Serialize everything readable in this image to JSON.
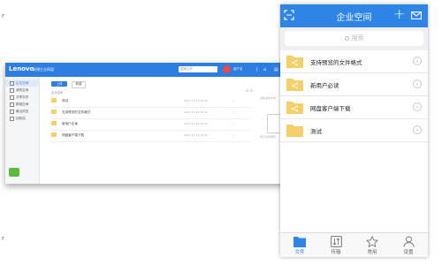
{
  "corner_marks": {
    "top_left": "r",
    "bottom_left": "r"
  },
  "desktop": {
    "logo": "Lenovo",
    "app_name": "联想企业网盘",
    "search_placeholder": "搜索文件",
    "user": "用户名",
    "nav": [
      "|",
      "⌂",
      "▤",
      "⚙"
    ],
    "sidebar": [
      {
        "label": "企业空间",
        "active": true
      },
      {
        "label": "我的空间",
        "active": false
      },
      {
        "label": "共享文件",
        "active": false
      },
      {
        "label": "群组空间",
        "active": false
      },
      {
        "label": "最近浏览",
        "active": false
      },
      {
        "label": "回收站",
        "active": false
      }
    ],
    "buttons": {
      "upload": "上传",
      "new": "新建"
    },
    "breadcrumb": "企业空间",
    "files": [
      {
        "name": "测试",
        "date": "2017-11-14 10:50",
        "check": "○"
      },
      {
        "name": "支持预览的文件格式",
        "date": "2017-11-14 10:50",
        "check": "○"
      },
      {
        "name": "新用户必读",
        "date": "2017-11-14 10:50",
        "check": "○"
      },
      {
        "name": "网盘客户端下载",
        "date": "2017-11-14 10:50",
        "check": "○"
      }
    ],
    "preview_hint": "当前选中文件:",
    "preview_caption": "暂不支持预览"
  },
  "mobile": {
    "title": "企业空间",
    "plus": "+",
    "search_placeholder": "搜索",
    "items": [
      {
        "label": "支持预览的文件格式",
        "icon": "share-folder-icon"
      },
      {
        "label": "新用户必读",
        "icon": "share-folder-icon"
      },
      {
        "label": "网盘客户端下载",
        "icon": "share-folder-icon"
      },
      {
        "label": "测试",
        "icon": "folder-icon"
      }
    ],
    "chevron": "⌄",
    "tabs": [
      {
        "label": "文件",
        "icon": "folder-icon",
        "active": true
      },
      {
        "label": "传输",
        "icon": "transfer-icon",
        "active": false
      },
      {
        "label": "常用",
        "icon": "star-icon",
        "active": false
      },
      {
        "label": "设置",
        "icon": "user-icon",
        "active": false
      }
    ],
    "colors": {
      "accent": "#2e85e6",
      "folder": "#f5cf6a"
    }
  }
}
